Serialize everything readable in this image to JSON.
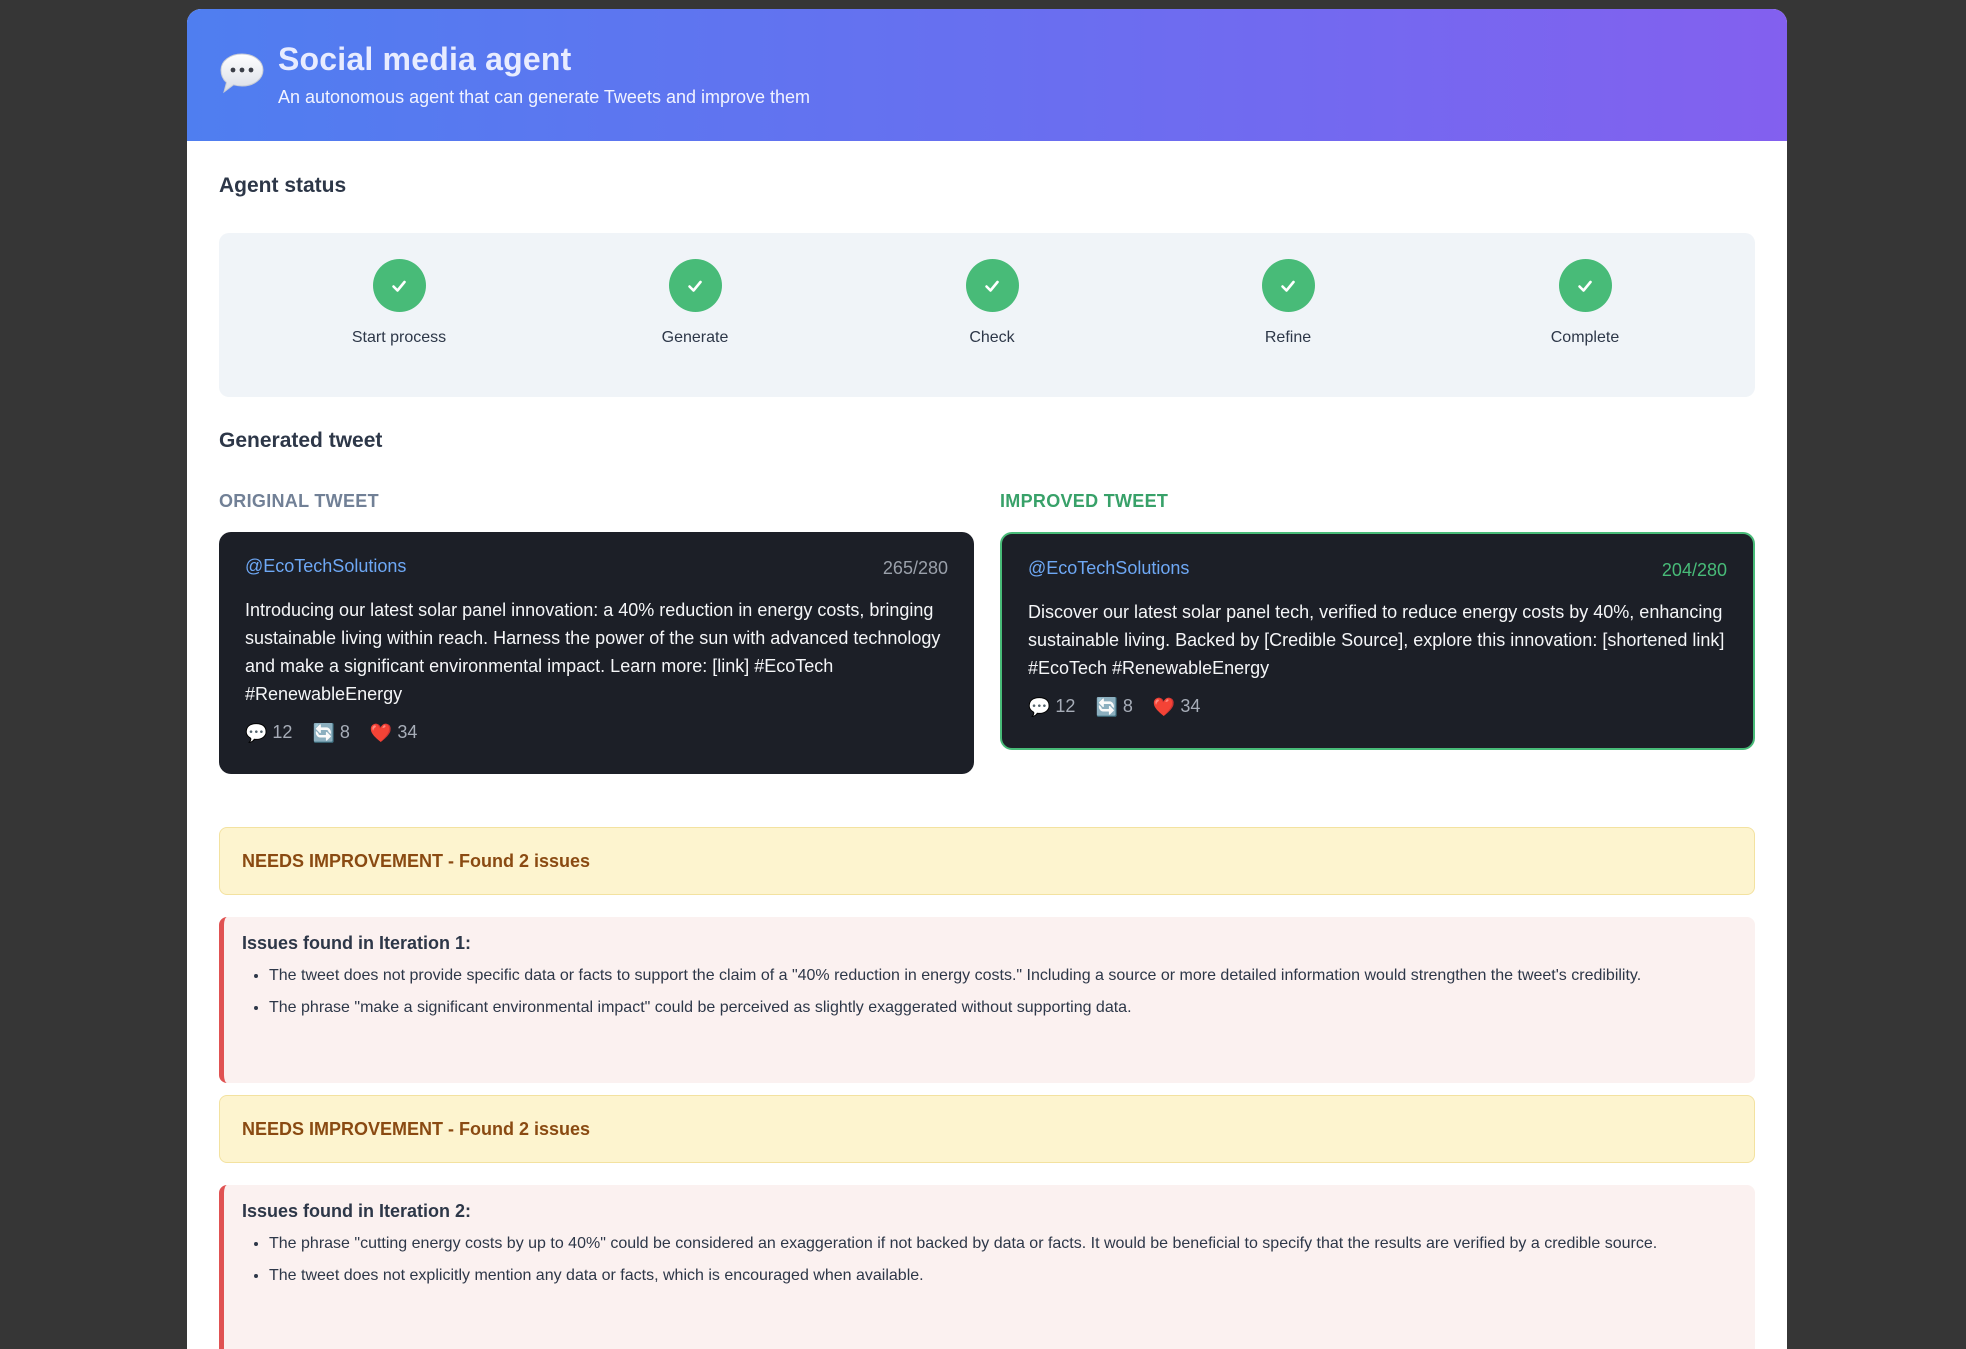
{
  "header": {
    "title": "Social media agent",
    "subtitle": "An autonomous agent that can generate Tweets and improve them",
    "logo_icon": "speech-bubble-icon"
  },
  "status": {
    "title": "Agent status",
    "steps": [
      {
        "label": "Start process",
        "state": "complete"
      },
      {
        "label": "Generate",
        "state": "complete"
      },
      {
        "label": "Check",
        "state": "complete"
      },
      {
        "label": "Refine",
        "state": "complete"
      },
      {
        "label": "Complete",
        "state": "complete"
      }
    ]
  },
  "generated": {
    "title": "Generated tweet",
    "original": {
      "label": "ORIGINAL TWEET",
      "handle": "@EcoTechSolutions",
      "count": "265/280",
      "text": "Introducing our latest solar panel innovation: a 40% reduction in energy costs, bringing sustainable living within reach. Harness the power of the sun with advanced technology and make a significant environmental impact. Learn more: [link] #EcoTech #RenewableEnergy",
      "replies": "12",
      "retweets": "8",
      "likes": "34"
    },
    "improved": {
      "label": "IMPROVED TWEET",
      "handle": "@EcoTechSolutions",
      "count": "204/280",
      "text": "Discover our latest solar panel tech, verified to reduce energy costs by 40%, enhancing sustainable living. Backed by [Credible Source], explore this innovation: [shortened link] #EcoTech #RenewableEnergy",
      "replies": "12",
      "retweets": "8",
      "likes": "34"
    }
  },
  "feedback": [
    {
      "banner": "NEEDS IMPROVEMENT - Found 2 issues",
      "title": "Issues found in Iteration 1:",
      "items": [
        "The tweet does not provide specific data or facts to support the claim of a \"40% reduction in energy costs.\" Including a source or more detailed information would strengthen the tweet's credibility.",
        "The phrase \"make a significant environmental impact\" could be perceived as slightly exaggerated without supporting data."
      ]
    },
    {
      "banner": "NEEDS IMPROVEMENT - Found 2 issues",
      "title": "Issues found in Iteration 2:",
      "items": [
        "The phrase \"cutting energy costs by up to 40%\" could be considered an exaggeration if not backed by data or facts. It would be beneficial to specify that the results are verified by a credible source.",
        "The tweet does not explicitly mention any data or facts, which is encouraged when available."
      ]
    }
  ],
  "colors": {
    "accent_start": "#4f7ef0",
    "accent_end": "#8360ef",
    "success": "#48bb78",
    "warning_bg": "#fdf4cf",
    "warning_text": "#8a4a12",
    "error": "#e05252",
    "original_label": "#718096",
    "improved_label": "#38a169"
  }
}
